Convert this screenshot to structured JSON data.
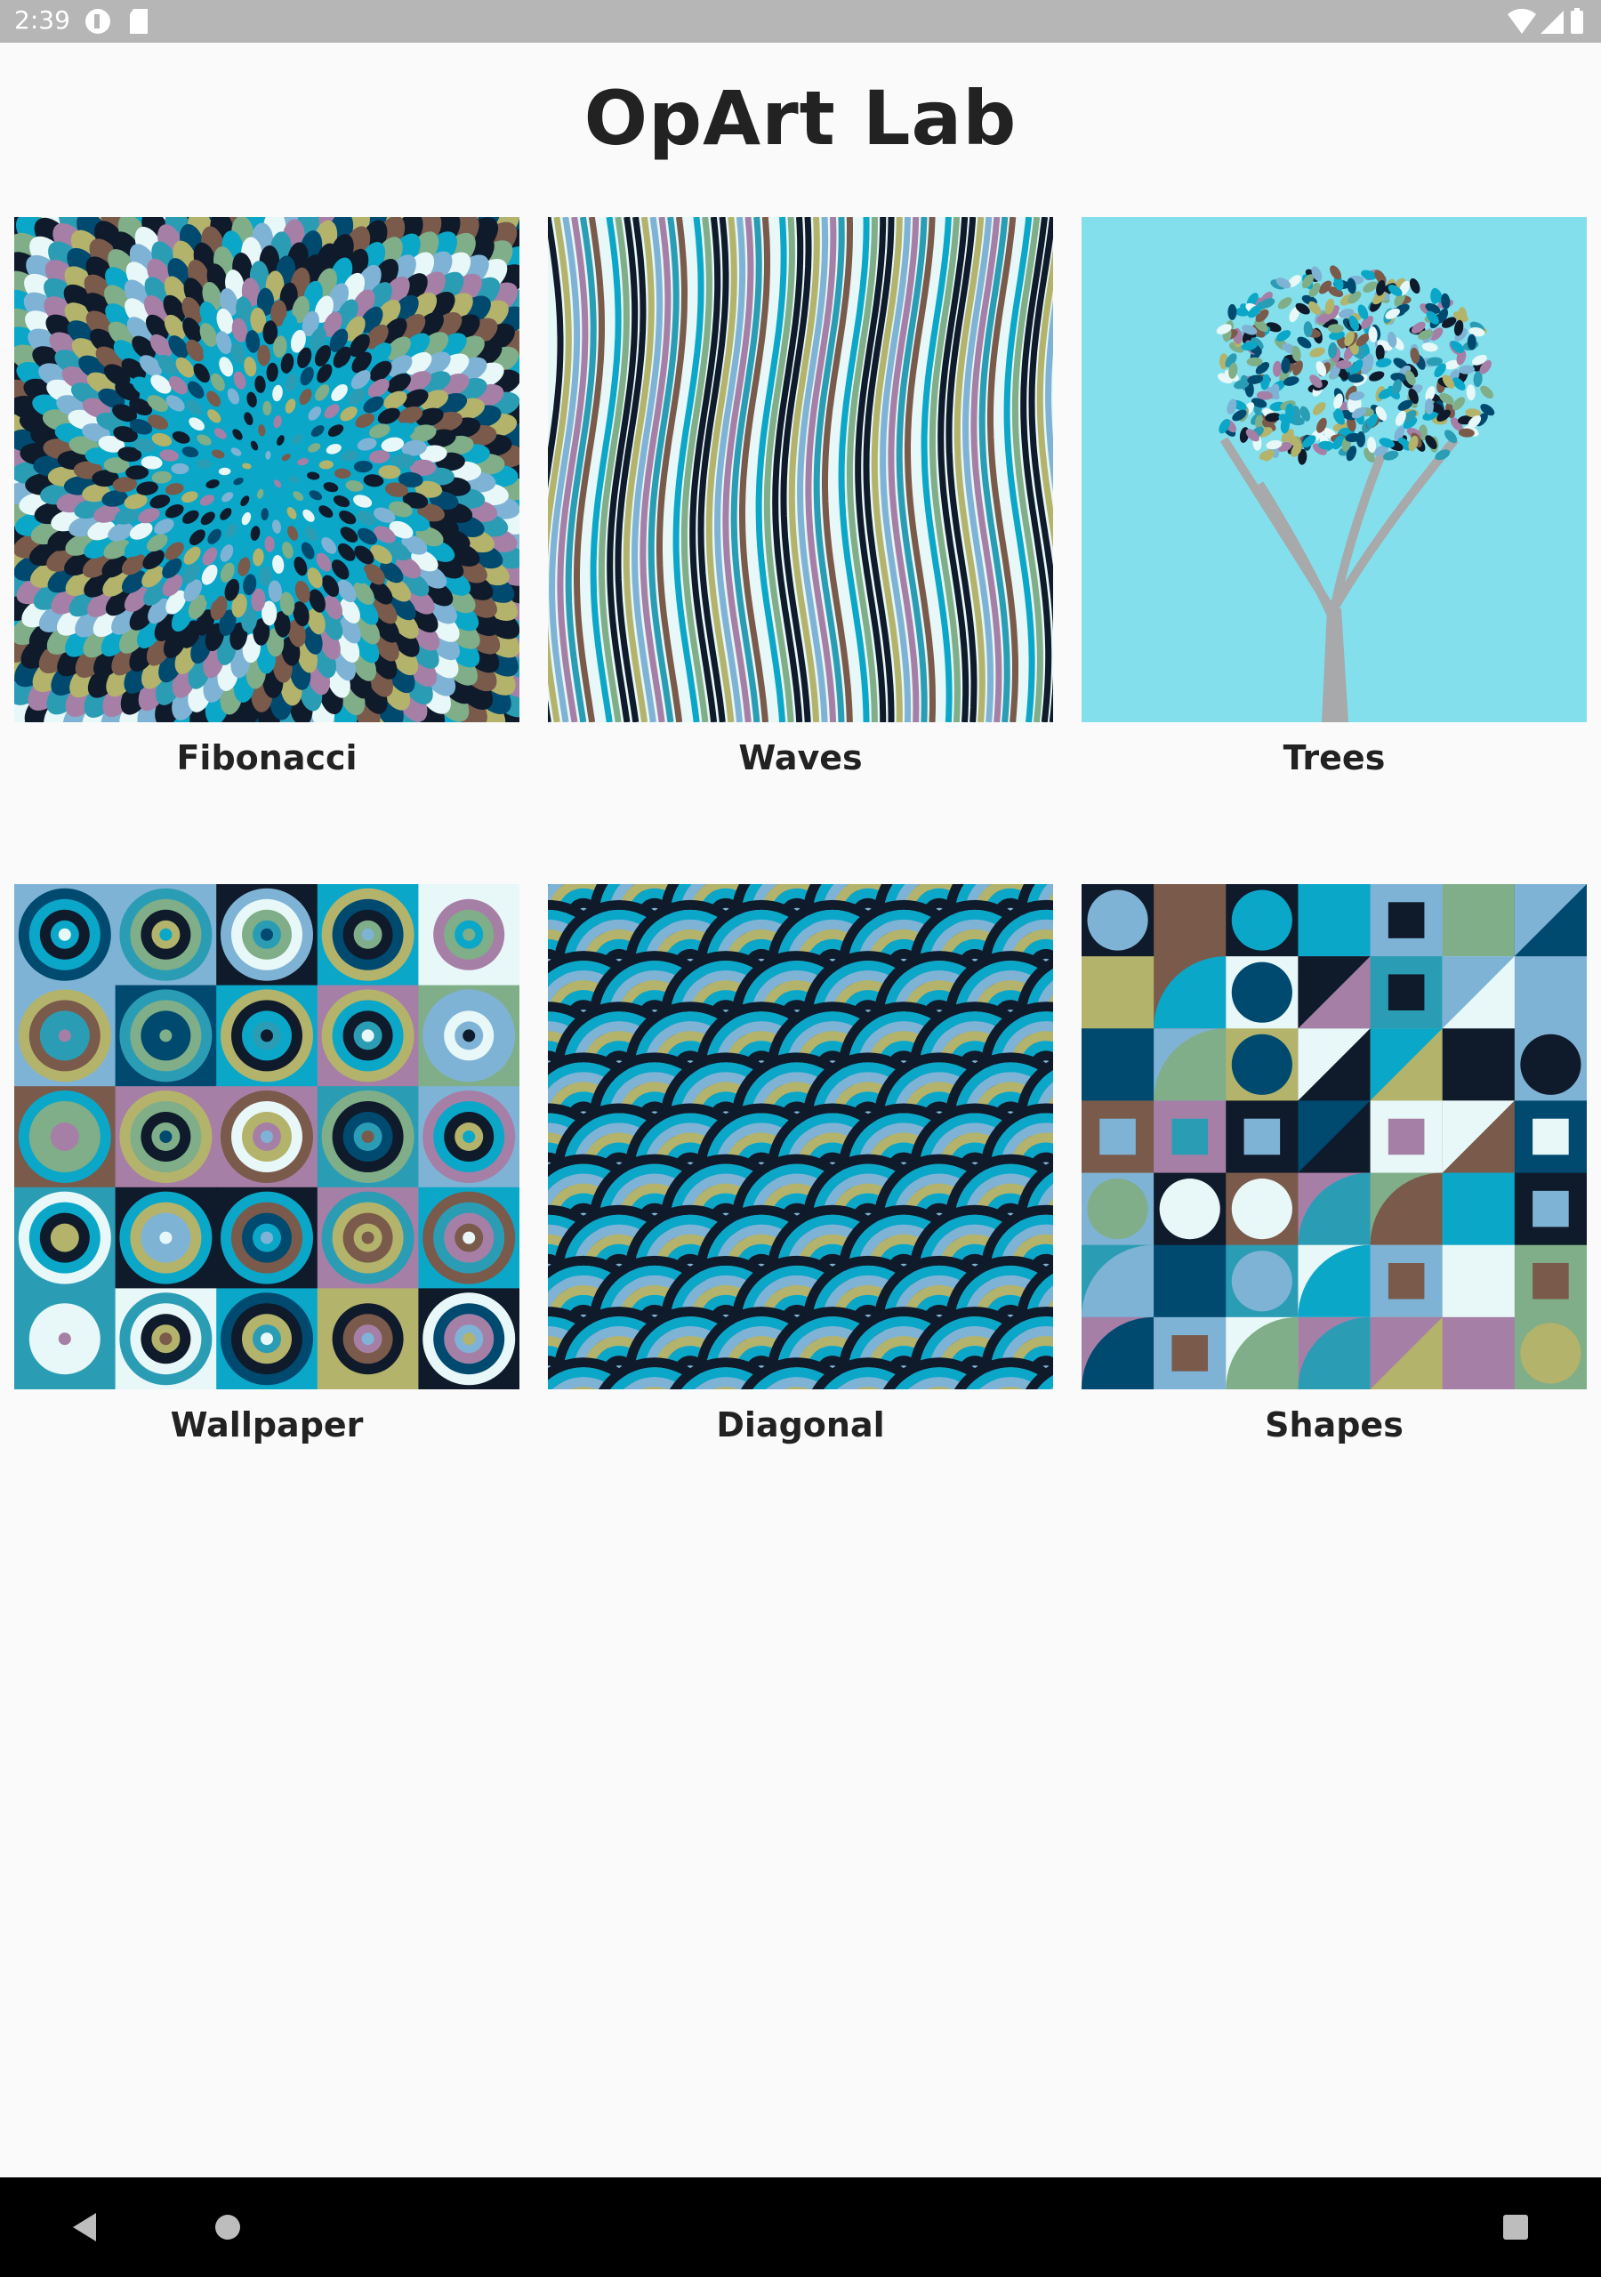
{
  "status_bar": {
    "time": "2:39"
  },
  "app": {
    "title": "OpArt Lab"
  },
  "gallery": {
    "items": [
      {
        "label": "Fibonacci"
      },
      {
        "label": "Waves"
      },
      {
        "label": "Trees"
      },
      {
        "label": "Wallpaper"
      },
      {
        "label": "Diagonal"
      },
      {
        "label": "Shapes"
      }
    ]
  },
  "palette": [
    "#0f1a2a",
    "#0aa7c9",
    "#7fb3d5",
    "#a67fa6",
    "#b3b36b",
    "#7a5a4a",
    "#7fae88",
    "#e8f7f7",
    "#2a9db5",
    "#004a70"
  ],
  "trees_background": "#84dfec",
  "nav": {
    "back": "back-icon",
    "home": "home-icon",
    "recents": "recents-icon"
  }
}
